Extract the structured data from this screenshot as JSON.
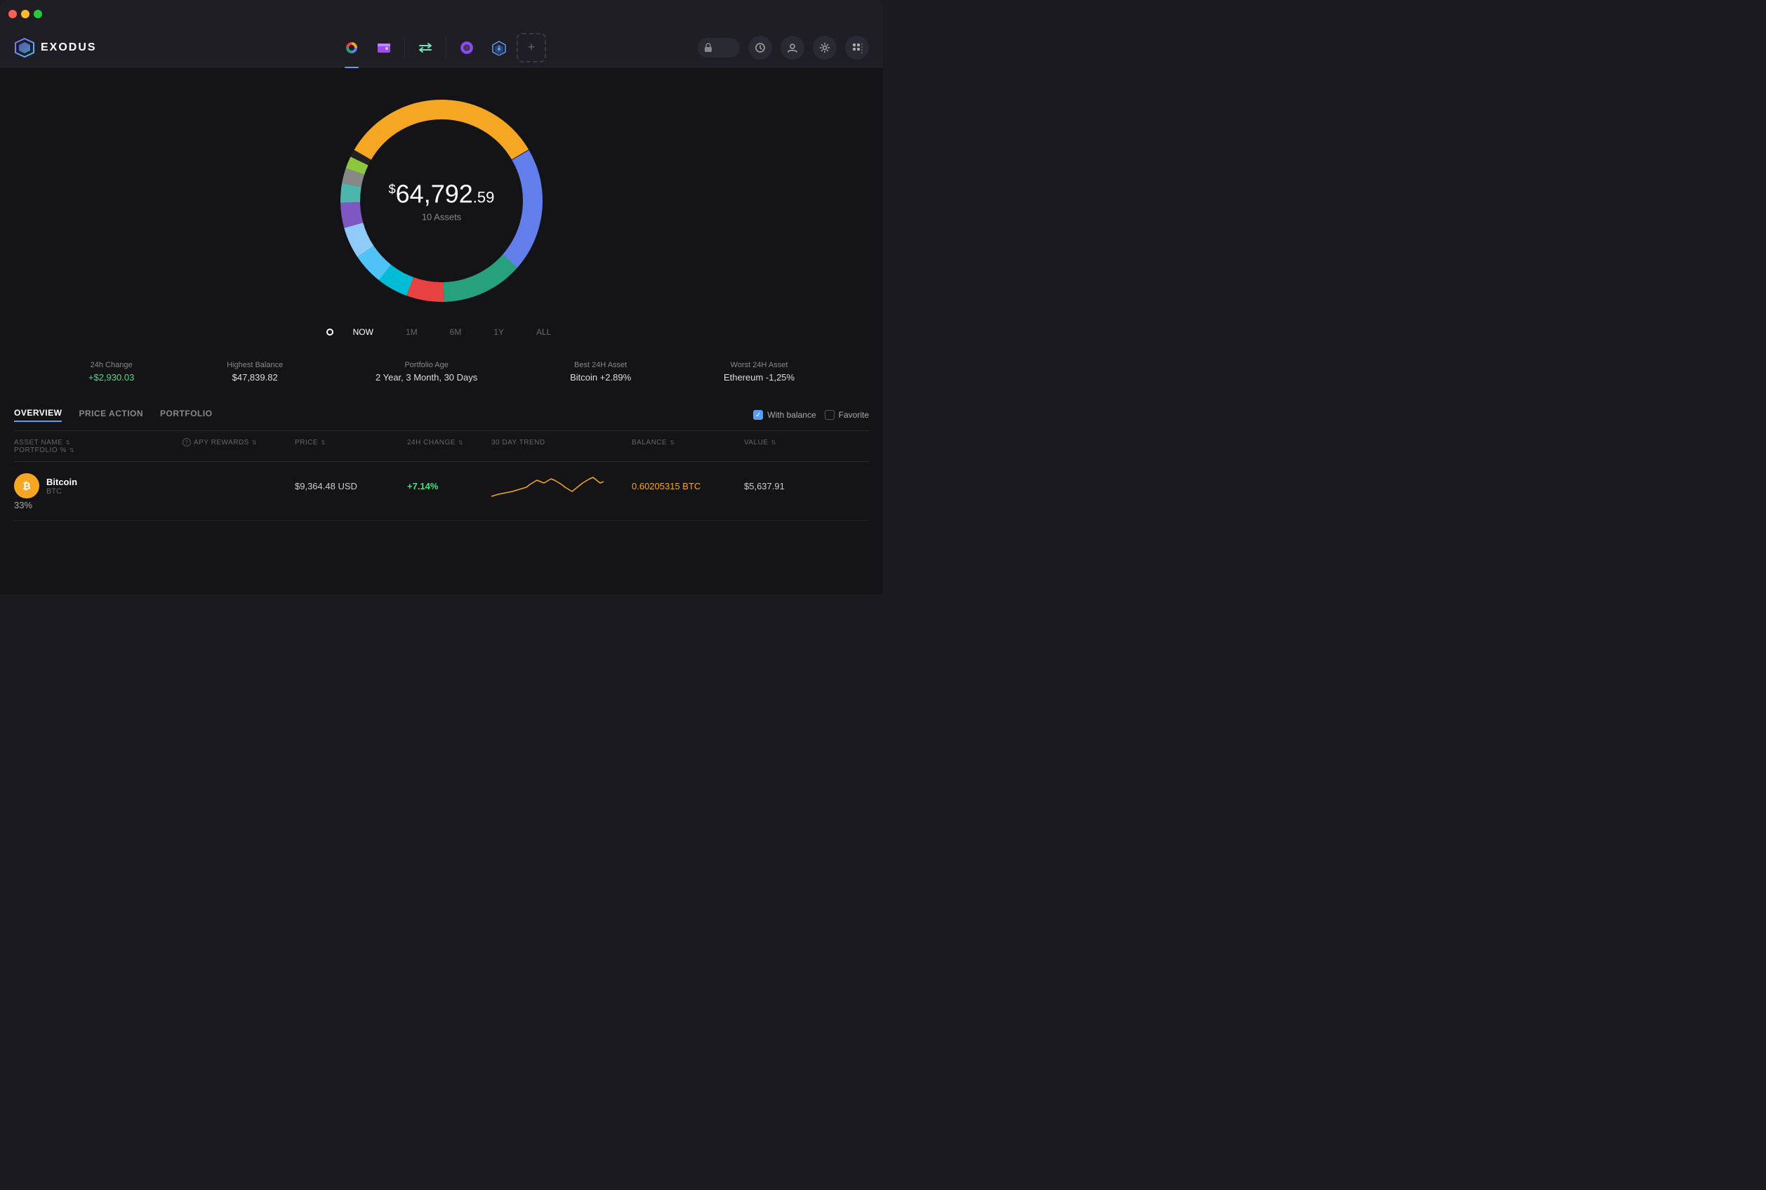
{
  "window": {
    "title": "Exodus"
  },
  "titleBar": {
    "lights": [
      "red",
      "yellow",
      "green"
    ]
  },
  "header": {
    "logo": {
      "text": "EXODUS"
    },
    "navTabs": [
      {
        "id": "portfolio",
        "label": "Portfolio",
        "active": true
      },
      {
        "id": "wallet",
        "label": "Wallet",
        "active": false
      },
      {
        "id": "exchange",
        "label": "Exchange",
        "active": false
      },
      {
        "id": "nft",
        "label": "NFT",
        "active": false
      },
      {
        "id": "earn",
        "label": "Earn",
        "active": false
      }
    ],
    "addTab": "+",
    "rightControls": {
      "lock": "🔒",
      "history": "⏱",
      "account": "👤",
      "settings": "⚙",
      "apps": "⊞"
    }
  },
  "chart": {
    "totalAmount": "64,792",
    "totalCents": ".59",
    "currencySymbol": "$",
    "assetsLabel": "10 Assets",
    "segments": [
      {
        "color": "#f5a623",
        "percentage": 33,
        "offset": 0
      },
      {
        "color": "#627eea",
        "percentage": 20,
        "offset": 33
      },
      {
        "color": "#26a17b",
        "percentage": 15,
        "offset": 53
      },
      {
        "color": "#e84142",
        "percentage": 10,
        "offset": 68
      },
      {
        "color": "#00ffa3",
        "percentage": 8,
        "offset": 78
      },
      {
        "color": "#f3ba2f",
        "percentage": 5,
        "offset": 86
      },
      {
        "color": "#8dc63f",
        "percentage": 4,
        "offset": 91
      },
      {
        "color": "#aaa",
        "percentage": 3,
        "offset": 95
      }
    ]
  },
  "timeline": {
    "items": [
      {
        "label": "NOW",
        "active": true
      },
      {
        "label": "1M",
        "active": false
      },
      {
        "label": "6M",
        "active": false
      },
      {
        "label": "1Y",
        "active": false
      },
      {
        "label": "ALL",
        "active": false
      }
    ]
  },
  "stats": [
    {
      "label": "24h Change",
      "value": "+$2,930.03",
      "positive": true
    },
    {
      "label": "Highest Balance",
      "value": "$47,839.82",
      "positive": false
    },
    {
      "label": "Portfolio Age",
      "value": "2 Year, 3 Month, 30 Days",
      "positive": false
    },
    {
      "label": "Best 24H Asset",
      "value": "Bitcoin +2.89%",
      "positive": false
    },
    {
      "label": "Worst 24H Asset",
      "value": "Ethereum -1,25%",
      "positive": false
    }
  ],
  "tableTabs": [
    {
      "label": "OVERVIEW",
      "active": true
    },
    {
      "label": "PRICE ACTION",
      "active": false
    },
    {
      "label": "PORTFOLIO",
      "active": false
    }
  ],
  "filters": [
    {
      "label": "With balance",
      "checked": true
    },
    {
      "label": "Favorite",
      "checked": false
    }
  ],
  "tableHeaders": [
    {
      "label": "ASSET NAME",
      "sortable": true
    },
    {
      "label": "APY REWARDS",
      "sortable": true,
      "hasInfo": true
    },
    {
      "label": "PRICE",
      "sortable": true
    },
    {
      "label": "24H CHANGE",
      "sortable": true
    },
    {
      "label": "30 DAY TREND",
      "sortable": false
    },
    {
      "label": "BALANCE",
      "sortable": true
    },
    {
      "label": "VALUE",
      "sortable": true
    },
    {
      "label": "PORTFOLIO %",
      "sortable": true
    }
  ],
  "tableRows": [
    {
      "name": "Bitcoin",
      "ticker": "BTC",
      "iconBg": "#f5a623",
      "iconText": "₿",
      "iconColor": "#fff",
      "apyRewards": "",
      "price": "$9,364.48 USD",
      "change24h": "+7.14%",
      "changePositive": true,
      "balance": "0.60205315 BTC",
      "balanceColor": "#f5a623",
      "value": "$5,637.91",
      "portfolio": "33%"
    }
  ]
}
